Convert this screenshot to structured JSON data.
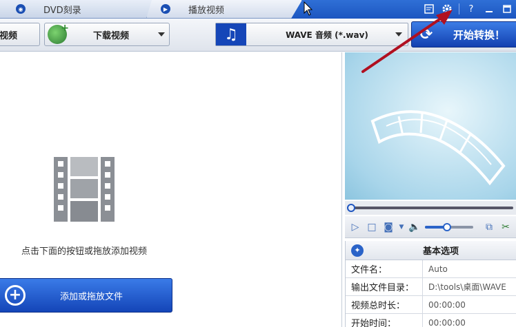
{
  "tabs": [
    {
      "label": "DVD刻录"
    },
    {
      "label": "播放视频"
    }
  ],
  "window_controls": {
    "help": "?"
  },
  "toolbar": {
    "add_label": "视频",
    "download_label": "下载视频",
    "format_label": "WAVE 音频 (*.wav)",
    "convert_label": "开始转换！"
  },
  "left_pane": {
    "hint": "点击下面的按钮或拖放添加视频",
    "add_file_label": "添加或拖放文件"
  },
  "options": {
    "title": "基本选项",
    "rows": [
      {
        "key": "文件名：",
        "value": "Auto"
      },
      {
        "key": "输出文件目录：",
        "value": "D:\\tools\\桌面\\WAVE"
      },
      {
        "key": "视频总时长：",
        "value": "00:00:00"
      },
      {
        "key": "开始时间：",
        "value": "00:00:00"
      }
    ]
  },
  "player": {
    "volume_fraction": 0.45
  },
  "colors": {
    "accent": "#1c56c0",
    "annotation": "#b01020"
  }
}
